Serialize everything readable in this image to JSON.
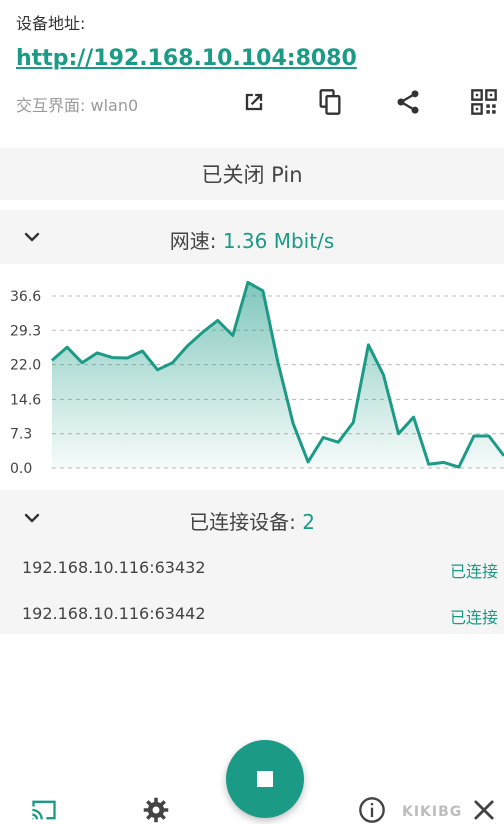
{
  "header": {
    "address_label": "设备地址:",
    "address_url": "http://192.168.10.104:8080",
    "interface_label": "交互界面: wlan0"
  },
  "pin": {
    "status": "已关闭 Pin"
  },
  "speed": {
    "label": "网速: ",
    "value": "1.36 Mbit/s"
  },
  "chart_data": {
    "type": "area",
    "yticks": [
      "36.6",
      "29.3",
      "22.0",
      "14.6",
      "7.3",
      "0.0"
    ],
    "ylim": [
      0,
      36.6
    ],
    "grid": true,
    "values": [
      22.9,
      25.7,
      22.4,
      24.5,
      23.5,
      23.4,
      24.9,
      20.9,
      22.4,
      26.0,
      28.9,
      31.4,
      28.2,
      39.5,
      37.7,
      22.4,
      9.5,
      1.3,
      6.5,
      5.5,
      9.7,
      26.2,
      19.8,
      7.3,
      10.8,
      0.8,
      1.2,
      0.2,
      6.8,
      6.8,
      2.6
    ],
    "color": "#1b9a86"
  },
  "devices": {
    "label": "已连接设备: ",
    "count": "2",
    "items": [
      {
        "address": "192.168.10.116:63432",
        "status": "已连接"
      },
      {
        "address": "192.168.10.116:63442",
        "status": "已连接"
      }
    ]
  },
  "watermark": "KIKIBG",
  "icons": {
    "open": "open-external-icon",
    "copy": "copy-icon",
    "share": "share-icon",
    "qr": "qr-code-icon",
    "cast": "cast-icon",
    "settings": "gear-icon",
    "info": "info-icon",
    "exit": "close-icon"
  }
}
